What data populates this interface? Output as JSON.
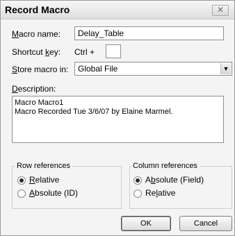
{
  "dialog": {
    "title": "Record Macro",
    "close_glyph": "✕"
  },
  "macro_name": {
    "label_mnemonic": "M",
    "label_rest": "acro name:",
    "value": "Delay_Table"
  },
  "shortcut": {
    "label_pre": "Shortcut ",
    "label_mnemonic": "k",
    "label_post": "ey:",
    "prefix": "Ctrl +",
    "value": ""
  },
  "store": {
    "label_mnemonic": "S",
    "label_rest": "tore macro in:",
    "selected": "Global File",
    "arrow_icon": "chevron-down-icon"
  },
  "description": {
    "label_mnemonic": "D",
    "label_rest": "escription:",
    "line1": "Macro Macro1",
    "line2": "Macro Recorded Tue 3/6/07 by Elaine Marmel."
  },
  "row_refs": {
    "title": "Row references",
    "opt1_mnemonic": "R",
    "opt1_rest": "elative",
    "opt1_checked": true,
    "opt2_mnemonic": "A",
    "opt2_rest": "bsolute (ID)",
    "opt2_checked": false
  },
  "col_refs": {
    "title": "Column references",
    "opt1_mnemonic": "b",
    "opt1_pre": "A",
    "opt1_rest": "solute (Field)",
    "opt1_checked": true,
    "opt2_pre": "Re",
    "opt2_mnemonic": "l",
    "opt2_rest": "ative",
    "opt2_checked": false
  },
  "buttons": {
    "ok": "OK",
    "cancel": "Cancel"
  }
}
